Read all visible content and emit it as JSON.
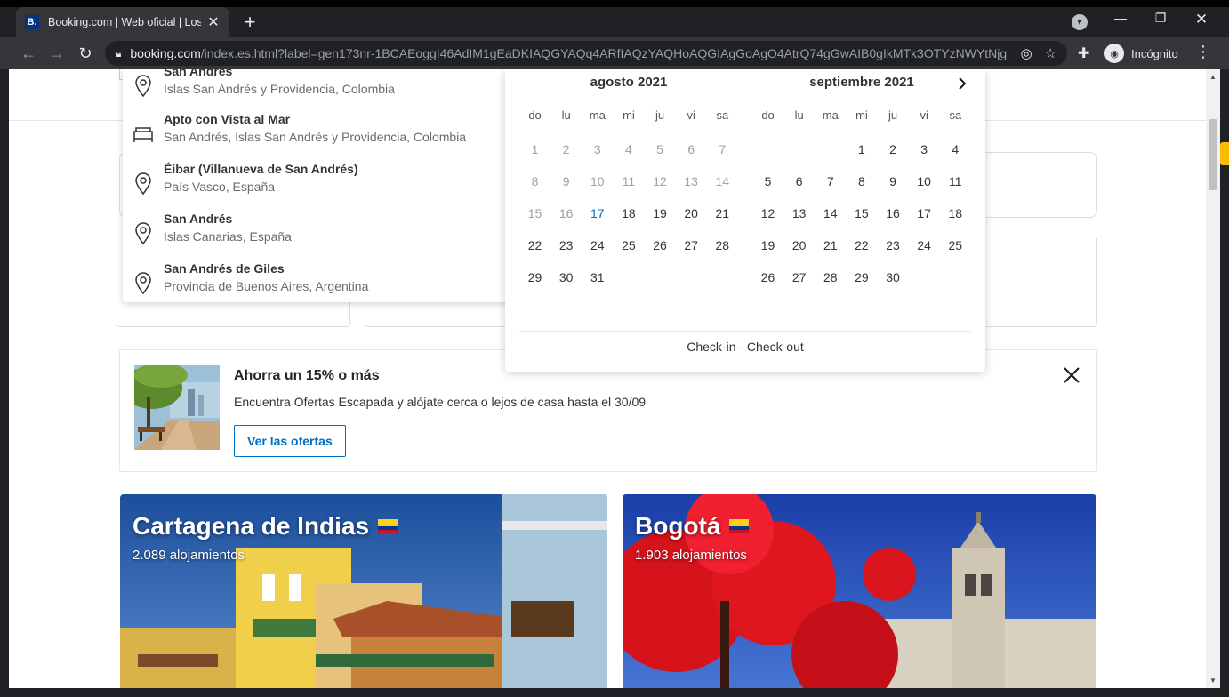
{
  "browser": {
    "tab_title": "Booking.com | Web oficial | Los m",
    "favicon_letter": "B.",
    "new_tab_label": "+",
    "url_host": "booking.com",
    "url_rest": "/index.es.html?label=gen173nr-1BCAEoggI46AdIM1gEaDKIAQGYAQq4ARfIAQzYAQHoAQGIAgGoAgO4AtrQ74gGwAIB0gIkMTk3OTYzNWYtNjg...",
    "incognito_label": "Incógnito"
  },
  "autocomplete": {
    "items": [
      {
        "title": "San Andrés",
        "subtitle": "Islas San Andrés y Providencia, Colombia",
        "icon": "pin-icon"
      },
      {
        "title": "Apto con Vista al Mar",
        "subtitle": "San Andrés, Islas San Andrés y Providencia, Colombia",
        "icon": "bed-icon"
      },
      {
        "title": "Éibar (Villanueva de San Andrés)",
        "subtitle": "País Vasco, España",
        "icon": "pin-icon"
      },
      {
        "title": "San Andrés",
        "subtitle": "Islas Canarias, España",
        "icon": "pin-icon"
      },
      {
        "title": "San Andrés de Giles",
        "subtitle": "Provincia de Buenos Aires, Argentina",
        "icon": "pin-icon"
      }
    ]
  },
  "calendar": {
    "weekdays": [
      "do",
      "lu",
      "ma",
      "mi",
      "ju",
      "vi",
      "sa"
    ],
    "months": [
      {
        "title": "agosto 2021",
        "offset": 0,
        "days": 31,
        "past_before": 17,
        "today": 17
      },
      {
        "title": "septiembre 2021",
        "offset": 3,
        "days": 30,
        "past_before": 0,
        "today": 0
      }
    ],
    "footer": "Check-in - Check-out"
  },
  "promo": {
    "title": "Ahorra un 15% o más",
    "text": "Encuentra Ofertas Escapada y alójate cerca o lejos de casa hasta el 30/09",
    "button": "Ver las ofertas"
  },
  "destinations": [
    {
      "name": "Cartagena de Indias",
      "count": "2.089 alojamientos"
    },
    {
      "name": "Bogotá",
      "count": "1.903 alojamientos"
    }
  ],
  "colors": {
    "brand_blue": "#003580",
    "link_blue": "#0071c2",
    "colombia_yellow": "#fcd116",
    "colombia_blue": "#003893",
    "colombia_red": "#ce1126"
  }
}
